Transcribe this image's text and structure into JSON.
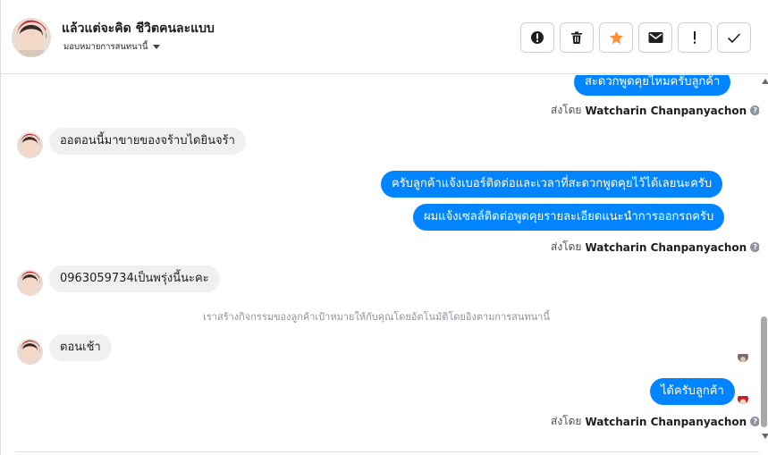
{
  "header": {
    "contact_name": "แล้วแต่จะคิด ชีวิตคนละแบบ",
    "assign_label": "มอบหมายการสนทนานี้",
    "tools": [
      {
        "name": "report-spam-button",
        "icon": "alert-circle-icon"
      },
      {
        "name": "delete-button",
        "icon": "trash-icon"
      },
      {
        "name": "star-button",
        "icon": "star-icon"
      },
      {
        "name": "mark-unread-button",
        "icon": "envelope-icon"
      },
      {
        "name": "follow-up-button",
        "icon": "exclamation-icon"
      },
      {
        "name": "mark-done-button",
        "icon": "checkmark-icon"
      }
    ]
  },
  "colors": {
    "outgoing_bubble": "#0084ff",
    "incoming_bubble": "#f1f0f0",
    "star": "#f7923a"
  },
  "messages": [
    {
      "dir": "out",
      "text": "สะดวกพูดคุยไหมครับลูกค้า"
    },
    {
      "dir": "meta",
      "prefix": "ส่งโดย",
      "sender": "Watcharin Chanpanyachon"
    },
    {
      "dir": "in",
      "text": "ออตอนนี้มาขายของจร้าบไดยินจร้า"
    },
    {
      "dir": "out",
      "text": "ครับลูกค้าแจ้งเบอร์ติดต่อและเวลาที่สะดวกพูดคุยไว้ได้เลยนะครับ"
    },
    {
      "dir": "out",
      "text": "ผมแจ้งเซลล์ติดต่อพูดคุยรายละเอียดแนะนำการออกรถครับ"
    },
    {
      "dir": "meta",
      "prefix": "ส่งโดย",
      "sender": "Watcharin Chanpanyachon"
    },
    {
      "dir": "in",
      "text": "0963059734เป็นพรุ่งนี้นะคะ"
    },
    {
      "dir": "system",
      "text": "เราสร้างกิจกรรมของลูกค้าเป้าหมายให้กับคุณโดยอัตโนมัติโดยอิงตามการสนทนานี้"
    },
    {
      "dir": "in",
      "text": "ตอนเช้า"
    },
    {
      "dir": "out",
      "text": "ได้ครับลูกค้า"
    },
    {
      "dir": "meta",
      "prefix": "ส่งโดย",
      "sender": "Watcharin Chanpanyachon"
    }
  ]
}
